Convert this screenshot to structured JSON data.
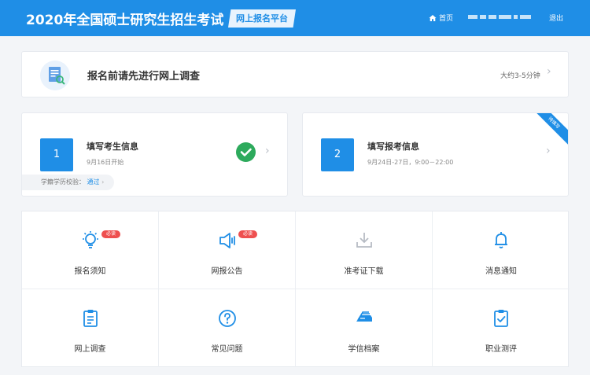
{
  "header": {
    "title": "2020年全国硕士研究生招生考试",
    "platform_tag": "网上报名平台",
    "home_label": "首页",
    "logout_label": "退出",
    "accent_color": "#1f8ee6"
  },
  "survey": {
    "title": "报名前请先进行网上调查",
    "time_hint": "大约3-5分钟"
  },
  "steps": [
    {
      "number": "1",
      "title": "填写考生信息",
      "subtitle": "9月16日开始",
      "check_label": "学籍学历校验：",
      "check_status": "通过",
      "completed": true
    },
    {
      "number": "2",
      "title": "填写报考信息",
      "subtitle": "9月24日-27日，9:00－22:00",
      "ribbon": "待填写"
    }
  ],
  "tiles": [
    {
      "label": "报名须知",
      "icon": "lightbulb-icon",
      "badge": "必读"
    },
    {
      "label": "网报公告",
      "icon": "megaphone-icon",
      "badge": "必读"
    },
    {
      "label": "准考证下载",
      "icon": "download-icon"
    },
    {
      "label": "消息通知",
      "icon": "bell-icon"
    },
    {
      "label": "网上调查",
      "icon": "clipboard-icon"
    },
    {
      "label": "常见问题",
      "icon": "question-icon"
    },
    {
      "label": "学信档案",
      "icon": "archive-icon"
    },
    {
      "label": "职业测评",
      "icon": "checklist-icon"
    }
  ]
}
